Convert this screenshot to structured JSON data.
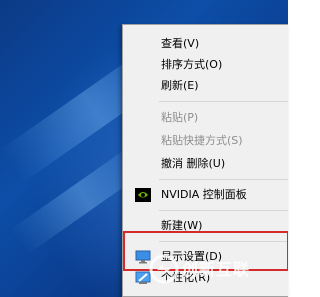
{
  "context_menu": {
    "items": [
      {
        "label": "查看(V)"
      },
      {
        "label": "排序方式(O)"
      },
      {
        "label": "刷新(E)"
      },
      {
        "label": "粘贴(P)"
      },
      {
        "label": "粘贴快捷方式(S)"
      },
      {
        "label": "撤消 删除(U)"
      },
      {
        "label": "NVIDIA 控制面板"
      },
      {
        "label": "新建(W)"
      },
      {
        "label": "显示设置(D)"
      },
      {
        "label": "个性化(R)"
      }
    ]
  },
  "watermark": {
    "text": "创新互联"
  },
  "colors": {
    "menu_bg": "#f0f0f0",
    "disabled_text": "#8e8e8e",
    "highlight_frame": "#d42a2a",
    "nvidia_green": "#76b900",
    "desktop_blue": "#0d4ea8"
  },
  "icons": {
    "nvidia": "nvidia-logo-icon",
    "display": "display-settings-icon",
    "personalize": "personalize-icon"
  }
}
